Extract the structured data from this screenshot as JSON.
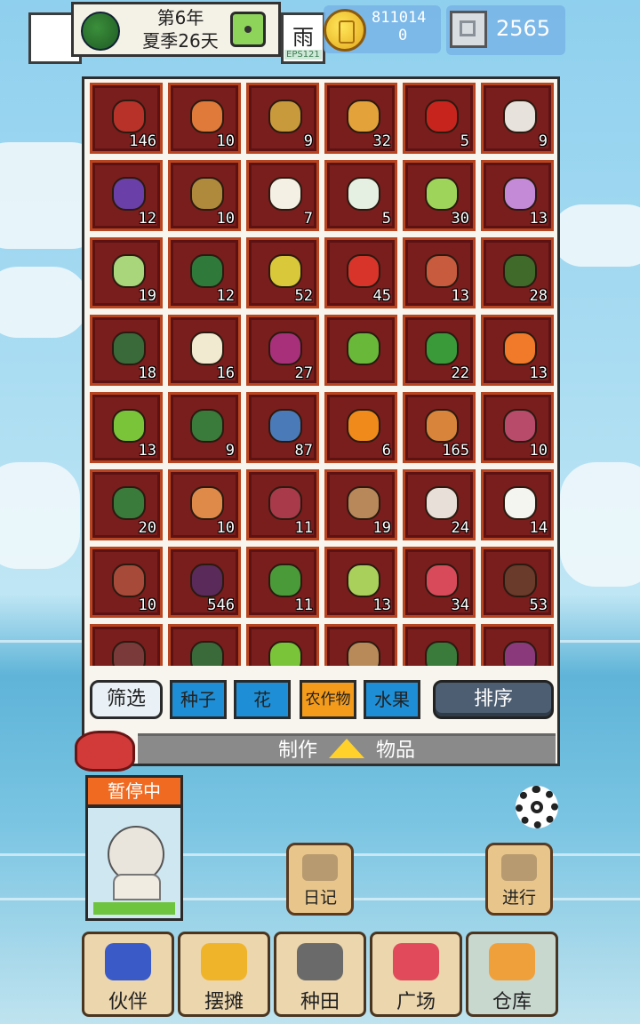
{
  "top_bar": {
    "date_line1": "第6年",
    "date_line2": "夏季26天",
    "weather": "雨",
    "eps": "EPS121",
    "coins_line1": "811014",
    "coins_line2": "0",
    "gems": "2565"
  },
  "inventory": {
    "items": [
      {
        "count": "146",
        "color": "#b8322a"
      },
      {
        "count": "10",
        "color": "#e07a3a"
      },
      {
        "count": "9",
        "color": "#c99a3c"
      },
      {
        "count": "32",
        "color": "#e3a23a"
      },
      {
        "count": "5",
        "color": "#c8241e"
      },
      {
        "count": "9",
        "color": "#e8e2dc"
      },
      {
        "count": "12",
        "color": "#6a3fa8"
      },
      {
        "count": "10",
        "color": "#b08a3c"
      },
      {
        "count": "7",
        "color": "#f4f0e4"
      },
      {
        "count": "5",
        "color": "#e6f0e2"
      },
      {
        "count": "30",
        "color": "#9fd45a"
      },
      {
        "count": "13",
        "color": "#c48ad8"
      },
      {
        "count": "19",
        "color": "#a9d67a"
      },
      {
        "count": "12",
        "color": "#2f7a3a"
      },
      {
        "count": "52",
        "color": "#d8c83a"
      },
      {
        "count": "45",
        "color": "#d8342a"
      },
      {
        "count": "13",
        "color": "#c85a3e"
      },
      {
        "count": "28",
        "color": "#3f6a2a"
      },
      {
        "count": "18",
        "color": "#3a6a3a"
      },
      {
        "count": "16",
        "color": "#f2ead0"
      },
      {
        "count": "27",
        "color": "#a8307a"
      },
      {
        "count": "",
        "color": "#6ab83a"
      },
      {
        "count": "22",
        "color": "#3a9a3a"
      },
      {
        "count": "13",
        "color": "#f07a2a"
      },
      {
        "count": "13",
        "color": "#7ac43a"
      },
      {
        "count": "9",
        "color": "#3a7a3a"
      },
      {
        "count": "87",
        "color": "#4a7ab8"
      },
      {
        "count": "6",
        "color": "#f08a1a"
      },
      {
        "count": "165",
        "color": "#d8843a"
      },
      {
        "count": "10",
        "color": "#b84a6a"
      },
      {
        "count": "20",
        "color": "#3a7a3a"
      },
      {
        "count": "10",
        "color": "#e08a4a"
      },
      {
        "count": "11",
        "color": "#a83a4a"
      },
      {
        "count": "19",
        "color": "#b8885a"
      },
      {
        "count": "24",
        "color": "#e8e0d8"
      },
      {
        "count": "14",
        "color": "#f4f4f0"
      },
      {
        "count": "10",
        "color": "#a84a3a"
      },
      {
        "count": "546",
        "color": "#5a2a5a"
      },
      {
        "count": "11",
        "color": "#4a9a3a"
      },
      {
        "count": "13",
        "color": "#a8d05a"
      },
      {
        "count": "34",
        "color": "#d84a5a"
      },
      {
        "count": "53",
        "color": "#6a3a2a"
      },
      {
        "count": "",
        "color": "#7a3a3a"
      },
      {
        "count": "",
        "color": "#3a6a3a"
      },
      {
        "count": "",
        "color": "#7ac43a"
      },
      {
        "count": "",
        "color": "#b88a5a"
      },
      {
        "count": "",
        "color": "#3a7a3a"
      },
      {
        "count": "",
        "color": "#8a3a7a"
      }
    ],
    "filter_label": "筛选",
    "tabs": [
      {
        "label": "种子",
        "active": false
      },
      {
        "label": "花",
        "active": false
      },
      {
        "label": "农作物",
        "active": true
      },
      {
        "label": "水果",
        "active": false
      }
    ],
    "sort_label": "排序",
    "craft_left": "制作",
    "craft_right": "物品"
  },
  "character": {
    "status": "暂停中",
    "hp_fraction": 1.0
  },
  "actions": {
    "diary": "日记",
    "proceed": "进行"
  },
  "bottom_nav": [
    {
      "label": "伙伴",
      "icon": "partners-icon",
      "color": "#3a5ac8"
    },
    {
      "label": "摆摊",
      "icon": "stall-icon",
      "color": "#f0b42a"
    },
    {
      "label": "种田",
      "icon": "watering-can-icon",
      "color": "#6a6a6a"
    },
    {
      "label": "广场",
      "icon": "flower-icon",
      "color": "#e04a5a"
    },
    {
      "label": "仓库",
      "icon": "house-icon",
      "color": "#f0a03a",
      "active": true
    }
  ]
}
